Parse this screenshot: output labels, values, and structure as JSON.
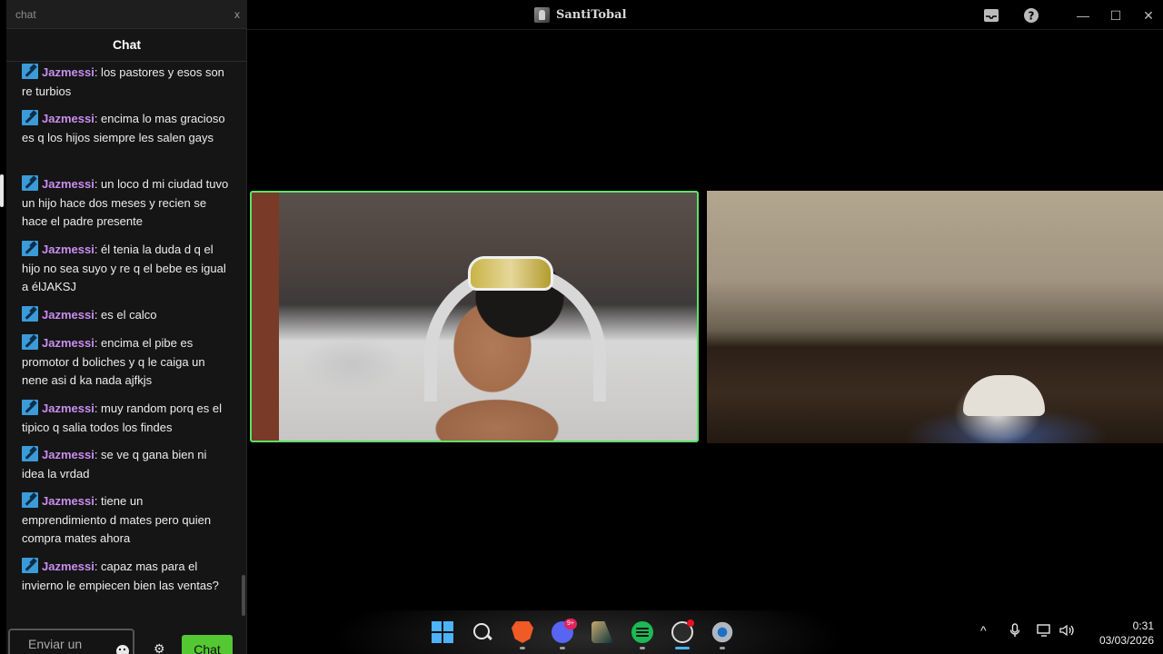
{
  "window": {
    "title": "SantiTobal",
    "controls": {
      "minimize": "—",
      "maximize": "☐",
      "close": "✕"
    }
  },
  "chat": {
    "search_text": "chat",
    "search_close": "x",
    "header": "Chat",
    "messages": [
      {
        "user": "Jazmessi",
        "text": ": los pastores y esos son re turbios"
      },
      {
        "user": "Jazmessi",
        "text": ": encima lo mas gracioso es q los hijos siempre les salen gays"
      },
      {
        "user": "Jazmessi",
        "text": ": un loco d mi ciudad tuvo un hijo hace dos meses y recien se hace el padre presente"
      },
      {
        "user": "Jazmessi",
        "text": ": él tenia la duda d q el hijo no sea suyo y re q el bebe es igual a élJAKSJ"
      },
      {
        "user": "Jazmessi",
        "text": ": es el calco"
      },
      {
        "user": "Jazmessi",
        "text": ": encima el pibe es promotor d boliches y q le caiga un nene asi d ka nada ajfkjs"
      },
      {
        "user": "Jazmessi",
        "text": ": muy random porq es el tipico q salia todos los findes"
      },
      {
        "user": "Jazmessi",
        "text": ": se ve q gana bien ni idea la vrdad"
      },
      {
        "user": "Jazmessi",
        "text": ": tiene un emprendimiento d mates pero quien compra mates ahora"
      },
      {
        "user": "Jazmessi",
        "text": ": capaz mas para el invierno le empiecen bien las ventas?"
      }
    ],
    "input_placeholder": "Enviar un",
    "send_label": "Chat"
  },
  "taskbar": {
    "icons": [
      "windows-start-icon",
      "search-icon",
      "brave-icon",
      "discord-icon",
      "league-of-legends-icon",
      "spotify-icon",
      "obs-icon",
      "settings-icon"
    ],
    "discord_badge": "9+",
    "time": "0:31",
    "date": "03/03/2026"
  },
  "colors": {
    "username": "#c98df0",
    "send_button": "#53c832",
    "active_video_border": "#5ee06a"
  }
}
